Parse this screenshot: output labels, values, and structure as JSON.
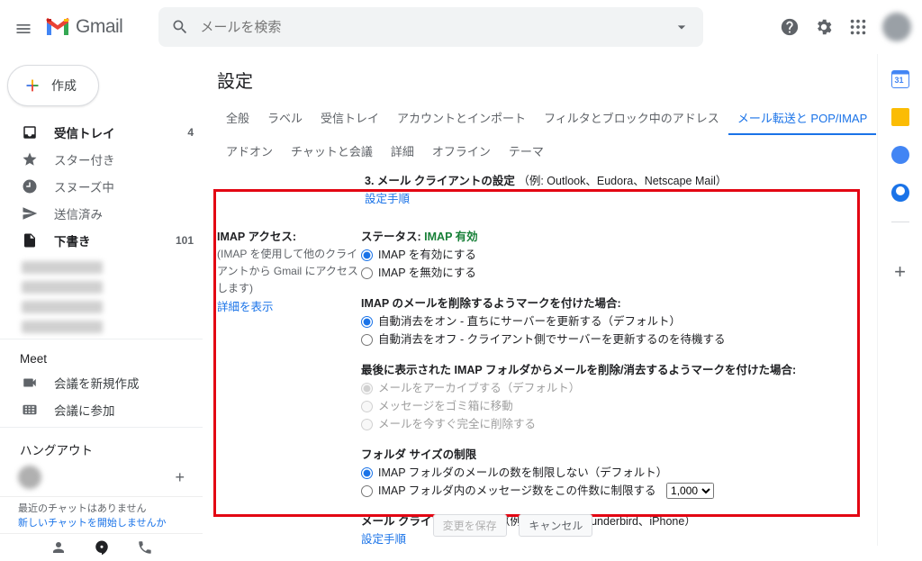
{
  "header": {
    "logo_text": "Gmail",
    "search_placeholder": "メールを検索"
  },
  "compose_label": "作成",
  "nav": {
    "inbox": {
      "label": "受信トレイ",
      "count": "4"
    },
    "starred": {
      "label": "スター付き"
    },
    "snoozed": {
      "label": "スヌーズ中"
    },
    "sent": {
      "label": "送信済み"
    },
    "drafts": {
      "label": "下書き",
      "count": "101"
    }
  },
  "meet": {
    "title": "Meet",
    "new": "会議を新規作成",
    "join": "会議に参加"
  },
  "hangout": {
    "title": "ハングアウト"
  },
  "chat_footer": {
    "line1": "最近のチャットはありません",
    "line2": "新しいチャットを開始しませんか"
  },
  "settings": {
    "title": "設定",
    "tabs": {
      "general": "全般",
      "labels": "ラベル",
      "inbox": "受信トレイ",
      "accounts": "アカウントとインポート",
      "filters": "フィルタとブロック中のアドレス",
      "forwarding": "メール転送と POP/IMAP",
      "addons": "アドオン",
      "chat": "チャットと会議",
      "advanced": "詳細",
      "offline": "オフライン",
      "themes": "テーマ"
    }
  },
  "top_section": {
    "heading": "3. メール クライアントの設定",
    "examples": "（例: Outlook、Eudora、Netscape Mail）",
    "link": "設定手順"
  },
  "imap": {
    "left": {
      "heading": "IMAP アクセス:",
      "sub": "(IMAP を使用して他のクライアントから Gmail にアクセスします)",
      "detail": "詳細を表示"
    },
    "status_label": "ステータス:",
    "status_value": "IMAP 有効",
    "enable": "IMAP を有効にする",
    "disable": "IMAP を無効にする",
    "delete_heading": "IMAP のメールを削除するようマークを付けた場合:",
    "delete_opt1": "自動消去をオン - 直ちにサーバーを更新する（デフォルト）",
    "delete_opt2": "自動消去をオフ - クライアント側でサーバーを更新するのを待機する",
    "last_heading": "最後に表示された IMAP フォルダからメールを削除/消去するようマークを付けた場合:",
    "last_opt1": "メールをアーカイブする（デフォルト）",
    "last_opt2": "メッセージをゴミ箱に移動",
    "last_opt3": "メールを今すぐ完全に削除する",
    "folder_heading": "フォルダ サイズの制限",
    "folder_opt1": "IMAP フォルダのメールの数を制限しない（デフォルト）",
    "folder_opt2": "IMAP フォルダ内のメッセージ数をこの件数に制限する",
    "folder_select": "1,000",
    "client_heading": "メール クライアントの設定",
    "client_examples": "（例: Outlook、Thunderbird、iPhone）",
    "client_link": "設定手順"
  },
  "buttons": {
    "save": "変更を保存",
    "cancel": "キャンセル"
  }
}
